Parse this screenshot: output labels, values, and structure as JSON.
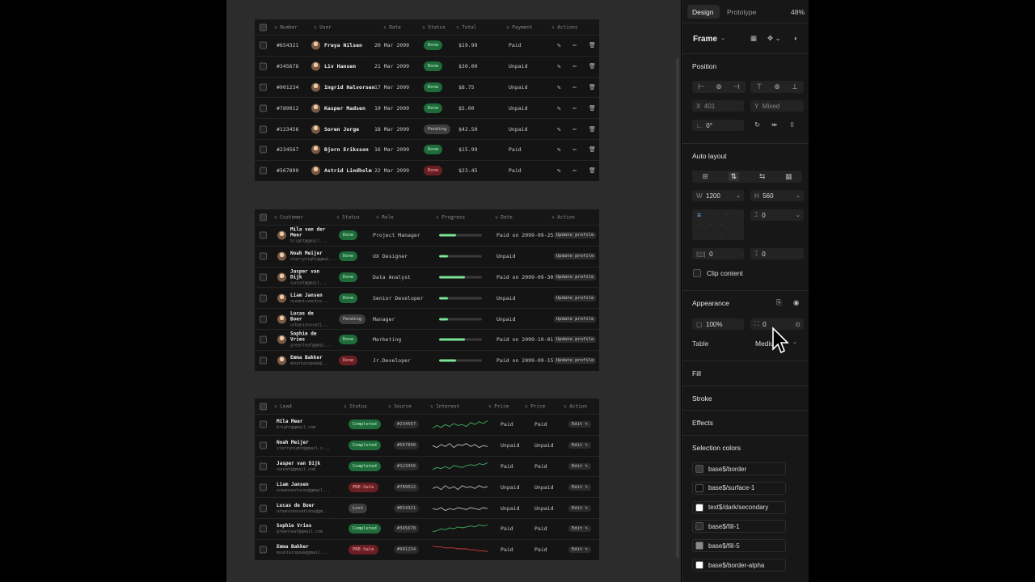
{
  "table1": {
    "headers": [
      "Number",
      "User",
      "Date",
      "Status",
      "Total",
      "Payment",
      "Actions"
    ],
    "rows": [
      {
        "num": "#654321",
        "user": "Freya Nilsen",
        "date": "20 Mar 2099",
        "status": "Done",
        "total": "$19.99",
        "payment": "Paid"
      },
      {
        "num": "#345678",
        "user": "Liv Hansen",
        "date": "21 Mar 2099",
        "status": "Done",
        "total": "$30.00",
        "payment": "Unpaid"
      },
      {
        "num": "#901234",
        "user": "Ingrid Halvorsen",
        "date": "17 Mar 2099",
        "status": "Done",
        "total": "$8.75",
        "payment": "Unpaid"
      },
      {
        "num": "#789012",
        "user": "Kasper Madsen",
        "date": "19 Mar 2099",
        "status": "Done",
        "total": "$5.00",
        "payment": "Unpaid"
      },
      {
        "num": "#123456",
        "user": "Soren Jorge",
        "date": "18 Mar 2099",
        "status": "Pending",
        "total": "$42.50",
        "payment": "Unpaid"
      },
      {
        "num": "#234567",
        "user": "Bjorn Eriksson",
        "date": "16 Mar 2099",
        "status": "Done",
        "total": "$15.99",
        "payment": "Paid"
      },
      {
        "num": "#567890",
        "user": "Astrid Lindholm",
        "date": "22 Mar 2099",
        "status": "Done",
        "total": "$23.45",
        "payment": "Paid"
      }
    ],
    "status_kinds": [
      "done",
      "done",
      "done",
      "done",
      "pending",
      "done",
      "pre"
    ]
  },
  "table2": {
    "headers": [
      "Customer",
      "Status",
      "Role",
      "Progress",
      "Date",
      "Action"
    ],
    "rows": [
      {
        "name": "Mila van der Meer",
        "email": "bright@gmail...",
        "status": "Done",
        "role": "Project Manager",
        "progress": 0.4,
        "date": "Paid on 2099-09-25",
        "action": "Update profile"
      },
      {
        "name": "Noah Meijer",
        "email": "starrynight@gmai...",
        "status": "Done",
        "role": "UX Designer",
        "progress": 0.2,
        "date": "Unpaid",
        "action": "Update profile"
      },
      {
        "name": "Jasper van Dijk",
        "email": "sunset@gmail...",
        "status": "Done",
        "role": "Data Analyst",
        "progress": 0.6,
        "date": "Paid on 2099-09-30",
        "action": "Update profile"
      },
      {
        "name": "Liam Jansen",
        "email": "oceanicventus...",
        "status": "Done",
        "role": "Senior Developer",
        "progress": 0.2,
        "date": "Unpaid",
        "action": "Update profile"
      },
      {
        "name": "Lucas de Boer",
        "email": "urbaninnovati...",
        "status": "Pending",
        "role": "Manager",
        "progress": 0.2,
        "date": "Unpaid",
        "action": "Update profile"
      },
      {
        "name": "Sophie de Vries",
        "email": "greenleaf@gmai...",
        "status": "Done",
        "role": "Marketing",
        "progress": 0.6,
        "date": "Paid on 2099-10-01",
        "action": "Update profile"
      },
      {
        "name": "Emma Bakker",
        "email": "mountainpeak@...",
        "status": "Done",
        "role": "Jr.Developer",
        "progress": 0.4,
        "date": "Paid on 2099-09-15",
        "action": "Update profile"
      }
    ],
    "status_kinds": [
      "done",
      "done",
      "done",
      "done",
      "pending",
      "done",
      "pre"
    ]
  },
  "table3": {
    "headers": [
      "Lead",
      "Status",
      "Source",
      "Interest",
      "Price",
      "Price",
      "Action"
    ],
    "rows": [
      {
        "name": "Mila Meer",
        "email": "bright@gmail.com",
        "status": "Completed",
        "source": "#234567",
        "price1": "Paid",
        "price2": "Paid",
        "action": "Edit"
      },
      {
        "name": "Noah Meijer",
        "email": "starrynight@gmail.c...",
        "status": "Completed",
        "source": "#567890",
        "price1": "Unpaid",
        "price2": "Unpaid",
        "action": "Edit"
      },
      {
        "name": "Jasper van Dijk",
        "email": "sunset@gmail.com",
        "status": "Completed",
        "source": "#123456",
        "price1": "Paid",
        "price2": "Paid",
        "action": "Edit"
      },
      {
        "name": "Liam Jansen",
        "email": "oceanventures@gmail...",
        "status": "PRE-Sale",
        "source": "#789012",
        "price1": "Unpaid",
        "price2": "Unpaid",
        "action": "Edit"
      },
      {
        "name": "Lucas de Boer",
        "email": "urbaninnovations@gm...",
        "status": "Lost",
        "source": "#654321",
        "price1": "Unpaid",
        "price2": "Unpaid",
        "action": "Edit"
      },
      {
        "name": "Sophie Vries",
        "email": "greenleaf@gmail.com",
        "status": "Completed",
        "source": "#345678",
        "price1": "Paid",
        "price2": "Paid",
        "action": "Edit"
      },
      {
        "name": "Emma Bakker",
        "email": "mountainpeak@gmail...",
        "status": "PRE-Sale",
        "source": "#901234",
        "price1": "Paid",
        "price2": "Paid",
        "action": "Edit"
      }
    ],
    "status_kinds": [
      "completed",
      "completed",
      "completed",
      "pre",
      "lost",
      "completed",
      "pre"
    ],
    "spark_colors": [
      "#3fae5d",
      "#bdbdbd",
      "#3fae5d",
      "#bdbdbd",
      "#bdbdbd",
      "#3fae5d",
      "#d23b3b"
    ]
  },
  "panel": {
    "tab_design": "Design",
    "tab_prototype": "Prototype",
    "zoom": "48%",
    "frame_label": "Frame",
    "position_title": "Position",
    "x_label": "X",
    "x_value": "401",
    "y_label": "Y",
    "y_value": "Mixed",
    "rotation": "0°",
    "auto_layout_title": "Auto layout",
    "w_label": "W",
    "w_value": "1200",
    "h_label": "H",
    "h_value": "560",
    "gap_value": "0",
    "pad_h": "0",
    "pad_v": "0",
    "clip_content": "Clip content",
    "appearance_title": "Appearance",
    "opacity": "100%",
    "radius": "0",
    "table_label": "Table",
    "table_value": "Mediu",
    "fill_title": "Fill",
    "stroke_title": "Stroke",
    "effects_title": "Effects",
    "selection_colors_title": "Selection colors",
    "colors": [
      {
        "name": "base$/border",
        "hex": "#3a3a3a"
      },
      {
        "name": "base$/surface-1",
        "hex": "#111111"
      },
      {
        "name": "text$/dark/secondary",
        "hex": "#ffffff"
      },
      {
        "name": "base$/fill-1",
        "hex": "#2e2e2e"
      },
      {
        "name": "base$/fill-5",
        "hex": "#8a8a8a"
      },
      {
        "name": "base$/border-alpha",
        "hex": "#ffffff"
      }
    ]
  }
}
